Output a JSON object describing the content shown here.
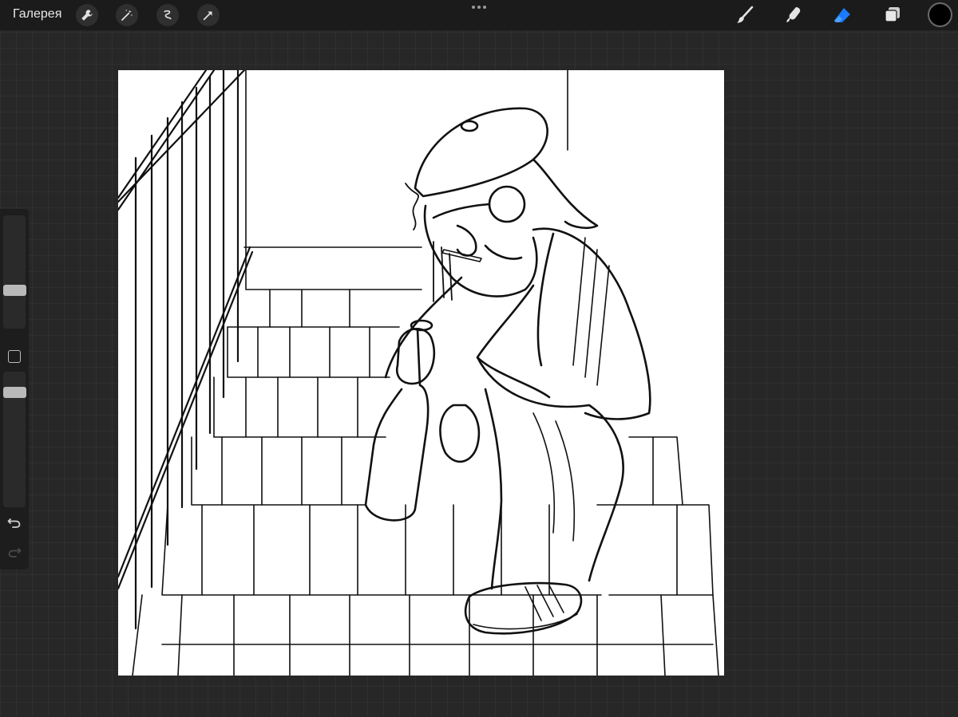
{
  "toolbar": {
    "gallery_label": "Галерея",
    "left_tools": [
      "wrench-icon",
      "magic-wand-icon",
      "selection-icon",
      "transform-arrow-icon"
    ],
    "right_tools": [
      "brush-icon",
      "smudge-icon",
      "eraser-icon",
      "layers-icon"
    ],
    "active_tool": "eraser",
    "active_color": "#000000",
    "accent_color": "#1a7bff"
  },
  "sidebar": {
    "brush_size_level": 0.2,
    "opacity_level": 0.9,
    "icons": [
      "modify-square-icon",
      "undo-icon",
      "redo-icon"
    ]
  },
  "canvas": {
    "background_color": "#ffffff",
    "subject": "line-art-illustration"
  }
}
